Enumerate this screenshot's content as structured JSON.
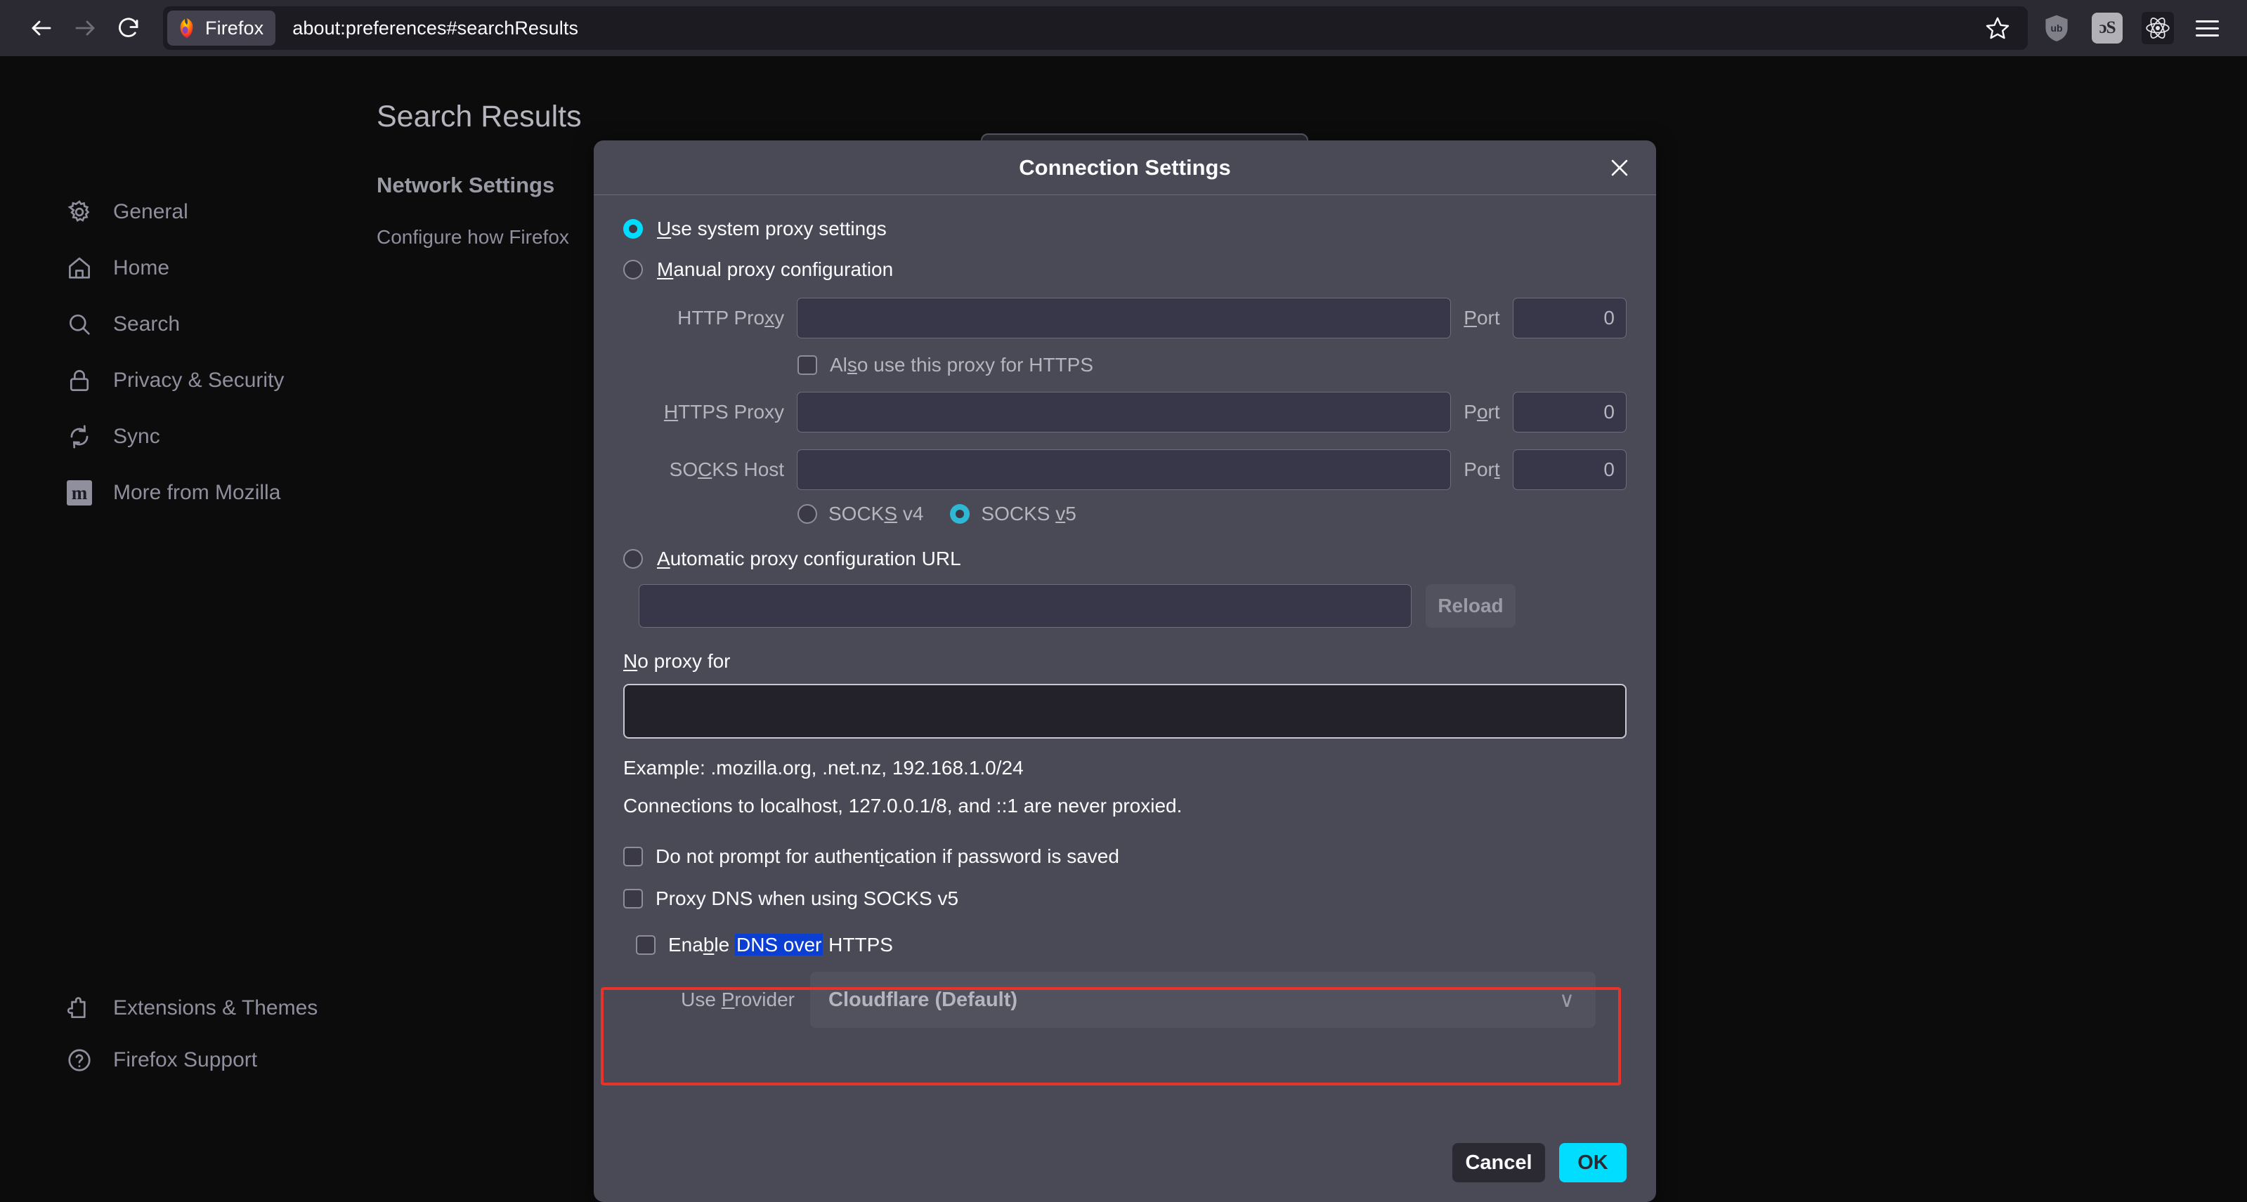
{
  "browser": {
    "back_icon": "arrow-left-icon",
    "forward_icon": "arrow-right-icon",
    "reload_icon": "reload-icon",
    "site_chip_label": "Firefox",
    "url": "about:preferences#searchResults",
    "bookmark_icon": "star-icon",
    "extensions": [
      {
        "name": "ublock-origin",
        "glyph": "ub"
      },
      {
        "name": "lastfm",
        "glyph": "ɔS"
      },
      {
        "name": "react-devtools",
        "glyph": "atom"
      }
    ],
    "menu_icon": "hamburger-menu-icon"
  },
  "sidebar": {
    "items": [
      {
        "label": "General",
        "icon": "gear-icon"
      },
      {
        "label": "Home",
        "icon": "home-icon"
      },
      {
        "label": "Search",
        "icon": "search-icon"
      },
      {
        "label": "Privacy & Security",
        "icon": "lock-icon"
      },
      {
        "label": "Sync",
        "icon": "sync-icon"
      },
      {
        "label": "More from Mozilla",
        "icon": "mozilla-icon"
      }
    ],
    "footer_items": [
      {
        "label": "Extensions & Themes",
        "icon": "puzzle-icon"
      },
      {
        "label": "Firefox Support",
        "icon": "question-circle-icon"
      }
    ]
  },
  "content": {
    "title": "Search Results",
    "section_heading": "Network Settings",
    "description": "Configure how Firefox"
  },
  "dialog": {
    "title": "Connection Settings",
    "close_icon": "close-icon",
    "proxy_mode": {
      "system": "Use system proxy settings",
      "manual": "Manual proxy configuration",
      "auto": "Automatic proxy configuration URL"
    },
    "fields": {
      "http_proxy_label": "HTTP Proxy",
      "http_proxy_value": "",
      "http_port_label": "Port",
      "http_port_value": "0",
      "also_https_label": "Also use this proxy for HTTPS",
      "https_proxy_label": "HTTPS Proxy",
      "https_proxy_value": "",
      "https_port_label": "Port",
      "https_port_value": "0",
      "socks_host_label": "SOCKS Host",
      "socks_host_value": "",
      "socks_port_label": "Port",
      "socks_port_value": "0",
      "socks_v4_label": "SOCKS v4",
      "socks_v5_label": "SOCKS v5",
      "pac_url_value": "",
      "reload_label": "Reload",
      "no_proxy_label": "No proxy for",
      "no_proxy_value": ""
    },
    "hints": {
      "example": "Example: .mozilla.org, .net.nz, 192.168.1.0/24",
      "localhost": "Connections to localhost, 127.0.0.1/8, and ::1 are never proxied."
    },
    "checkboxes": {
      "no_prompt_auth": "Do not prompt for authentication if password is saved",
      "proxy_dns_socks5": "Proxy DNS when using SOCKS v5"
    },
    "doh": {
      "enable_prefix": "Enable ",
      "enable_selected": "DNS over",
      "enable_suffix": " HTTPS",
      "provider_label": "Use Provider",
      "provider_value": "Cloudflare (Default)",
      "chevron": "∨"
    },
    "buttons": {
      "cancel": "Cancel",
      "ok": "OK"
    }
  },
  "colors": {
    "accent_cyan": "#00ddff",
    "selection_blue": "#0b3fd4",
    "highlight_red": "#e8322c",
    "dialog_bg": "#4a4a57",
    "page_bg": "#0c0c0d",
    "toolbar_bg": "#2b2a33"
  }
}
